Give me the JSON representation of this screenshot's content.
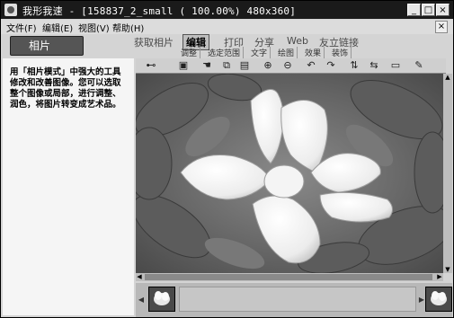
{
  "window": {
    "app_name": "我形我速",
    "title": "- [158837_2_small ( 100.00%) 480x360]",
    "controls": {
      "minimize": "_",
      "maximize": "□",
      "close": "×"
    }
  },
  "menu": [
    {
      "label": "文件(F)"
    },
    {
      "label": "编辑(E)"
    },
    {
      "label": "视图(V)"
    },
    {
      "label": "帮助(H)"
    }
  ],
  "menu_close": "×",
  "left_tab": {
    "label": "相片"
  },
  "tabs": [
    {
      "label": "获取相片"
    },
    {
      "label": "编辑",
      "active": true
    },
    {
      "label": "打印"
    },
    {
      "label": "分享"
    },
    {
      "label": "Web"
    },
    {
      "label": "友立链接"
    }
  ],
  "subtabs": [
    {
      "label": "调整"
    },
    {
      "label": "选定范围"
    },
    {
      "label": "文字"
    },
    {
      "label": "绘图"
    },
    {
      "label": "效果"
    },
    {
      "label": "装饰"
    }
  ],
  "description": "用「相片模式」中强大的工具修改和改善图像。您可以选取整个图像或局部，进行调整、润色，将图片转变成艺术品。",
  "toolbar_icons": [
    {
      "name": "slider-icon",
      "glyph": "⊷"
    },
    {
      "name": "save-icon",
      "glyph": "▣"
    },
    {
      "name": "hand-icon",
      "glyph": "☚"
    },
    {
      "name": "copy-icon",
      "glyph": "⧉"
    },
    {
      "name": "paste-icon",
      "glyph": "▤"
    },
    {
      "name": "zoom-in-icon",
      "glyph": "⊕"
    },
    {
      "name": "zoom-out-icon",
      "glyph": "⊖"
    },
    {
      "name": "undo-icon",
      "glyph": "↶"
    },
    {
      "name": "redo-icon",
      "glyph": "↷"
    },
    {
      "name": "flip-vertical-icon",
      "glyph": "⇅"
    },
    {
      "name": "flip-horizontal-icon",
      "glyph": "⇆"
    },
    {
      "name": "frame-icon",
      "glyph": "▭"
    },
    {
      "name": "wand-icon",
      "glyph": "✎"
    }
  ],
  "colors": {
    "titlebar_bg": "#1a1a1a",
    "window_bg": "#d4d4d4",
    "active_tab_bg": "#bfbfbf",
    "left_tab_bg": "#555555"
  }
}
